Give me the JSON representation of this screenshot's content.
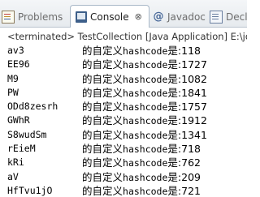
{
  "tabs": [
    {
      "label": "Problems",
      "icon": "problems-icon"
    },
    {
      "label": "Console",
      "icon": "console-icon",
      "active": true,
      "close": "⊗"
    },
    {
      "label": "Javadoc",
      "icon": "at-icon"
    },
    {
      "label": "Decla",
      "icon": "declaration-icon"
    }
  ],
  "console": {
    "status": "<terminated> TestCollection [Java Application] E:\\jdk",
    "lines": [
      {
        "name": "av3",
        "prefix": "的自定义",
        "mid": "hashcode",
        "suffix": "是:118"
      },
      {
        "name": "EE96",
        "prefix": "的自定义",
        "mid": "hashcode",
        "suffix": "是:1727"
      },
      {
        "name": "M9",
        "prefix": "的自定义",
        "mid": "hashcode",
        "suffix": "是:1082"
      },
      {
        "name": "PW",
        "prefix": "的自定义",
        "mid": "hashcode",
        "suffix": "是:1841"
      },
      {
        "name": "ODd8zesrh",
        "prefix": "的自定义",
        "mid": "hashcode",
        "suffix": "是:1757"
      },
      {
        "name": "GWhR",
        "prefix": "的自定义",
        "mid": "hashcode",
        "suffix": "是:1912"
      },
      {
        "name": "S8wudSm",
        "prefix": "的自定义",
        "mid": "hashcode",
        "suffix": "是:1341"
      },
      {
        "name": "rEieM",
        "prefix": "的自定义",
        "mid": "hashcode",
        "suffix": "是:718"
      },
      {
        "name": "kRi",
        "prefix": "的自定义",
        "mid": "hashcode",
        "suffix": "是:762"
      },
      {
        "name": "aV",
        "prefix": "的自定义",
        "mid": "hashcode",
        "suffix": "是:209"
      },
      {
        "name": "HfTvu1jO",
        "prefix": "的自定义",
        "mid": "hashcode",
        "suffix": "是:721"
      }
    ]
  },
  "colors": {
    "tab_bar": "#e6eaee",
    "active_tab": "#ffffff",
    "console_bg": "#ffffff",
    "text": "#000000"
  }
}
